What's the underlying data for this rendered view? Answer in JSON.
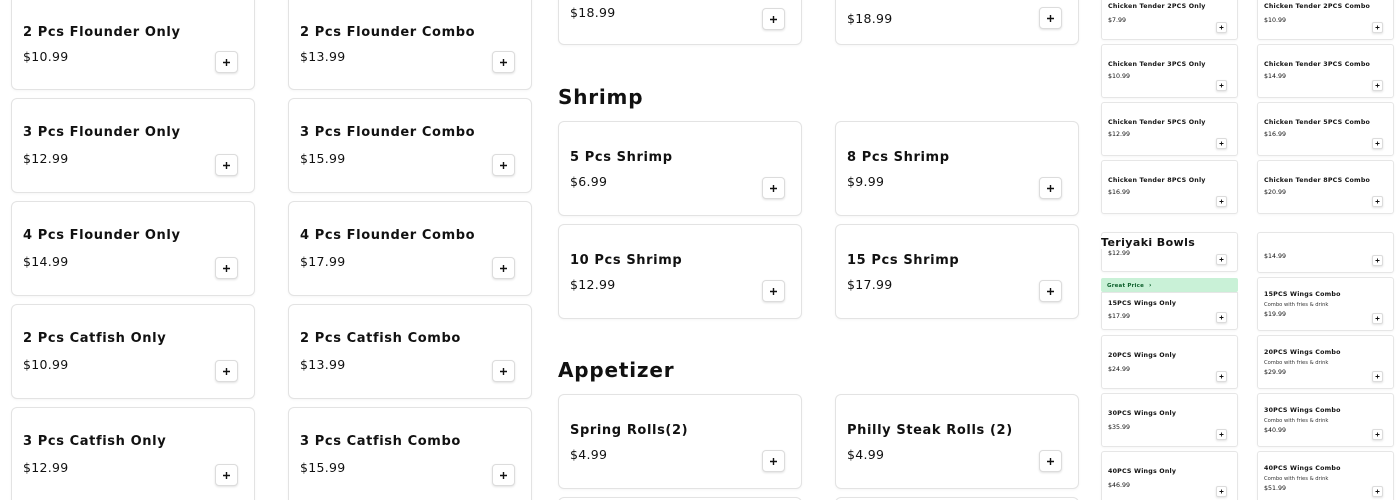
{
  "flounder_catfish": {
    "items": [
      {
        "name": "2 Pcs Flounder Only",
        "price": "$10.99"
      },
      {
        "name": "2 Pcs Flounder Combo",
        "price": "$13.99"
      },
      {
        "name": "3 Pcs Flounder Only",
        "price": "$12.99"
      },
      {
        "name": "3 Pcs Flounder Combo",
        "price": "$15.99"
      },
      {
        "name": "4 Pcs Flounder Only",
        "price": "$14.99"
      },
      {
        "name": "4 Pcs Flounder Combo",
        "price": "$17.99"
      },
      {
        "name": "2 Pcs Catfish Only",
        "price": "$10.99"
      },
      {
        "name": "2 Pcs Catfish Combo",
        "price": "$13.99"
      },
      {
        "name": "3 Pcs Catfish Only",
        "price": "$12.99"
      },
      {
        "name": "3 Pcs Catfish Combo",
        "price": "$15.99"
      }
    ]
  },
  "top_partial": {
    "items": [
      {
        "price": "$18.99"
      },
      {
        "price": "$18.99"
      }
    ]
  },
  "shrimp": {
    "title": "Shrimp",
    "items": [
      {
        "name": "5 Pcs Shrimp",
        "price": "$6.99"
      },
      {
        "name": "8 Pcs Shrimp",
        "price": "$9.99"
      },
      {
        "name": "10 Pcs Shrimp",
        "price": "$12.99"
      },
      {
        "name": "15 Pcs Shrimp",
        "price": "$17.99"
      }
    ]
  },
  "appetizer": {
    "title": "Appetizer",
    "items": [
      {
        "name": "Spring Rolls(2)",
        "price": "$4.99"
      },
      {
        "name": "Philly Steak Rolls (2)",
        "price": "$4.99"
      }
    ]
  },
  "chicken_tender": {
    "items": [
      {
        "name": "Chicken Tender 2PCS Only",
        "price": "$7.99"
      },
      {
        "name": "Chicken Tender 2PCS Combo",
        "price": "$10.99"
      },
      {
        "name": "Chicken Tender 3PCS Only",
        "price": "$10.99"
      },
      {
        "name": "Chicken Tender 3PCS Combo",
        "price": "$14.99"
      },
      {
        "name": "Chicken Tender 5PCS Only",
        "price": "$12.99"
      },
      {
        "name": "Chicken Tender 5PCS Combo",
        "price": "$16.99"
      },
      {
        "name": "Chicken Tender 8PCS Only",
        "price": "$16.99"
      },
      {
        "name": "Chicken Tender 8PCS Combo",
        "price": "$20.99"
      }
    ]
  },
  "teriyaki": {
    "title": "Teriyaki Bowls"
  },
  "wings": {
    "partial_left_price": "$12.99",
    "partial_right_price": "$14.99",
    "great_price_label": "Great Price",
    "great_price_chevron": "›",
    "items": [
      {
        "name": "15PCS Wings Only",
        "price": "$17.99"
      },
      {
        "name": "15PCS Wings Combo",
        "desc": "Combo with fries & drink",
        "price": "$19.99"
      },
      {
        "name": "20PCS Wings Only",
        "price": "$24.99"
      },
      {
        "name": "20PCS Wings Combo",
        "desc": "Combo with fries & drink",
        "price": "$29.99"
      },
      {
        "name": "30PCS Wings Only",
        "price": "$35.99"
      },
      {
        "name": "30PCS Wings Combo",
        "desc": "Combo with fries & drink",
        "price": "$40.99"
      },
      {
        "name": "40PCS Wings Only",
        "price": "$46.99"
      },
      {
        "name": "40PCS Wings Combo",
        "desc": "Combo with fries & drink",
        "price": "$51.99"
      }
    ]
  },
  "icons": {
    "add": "plus-icon"
  }
}
